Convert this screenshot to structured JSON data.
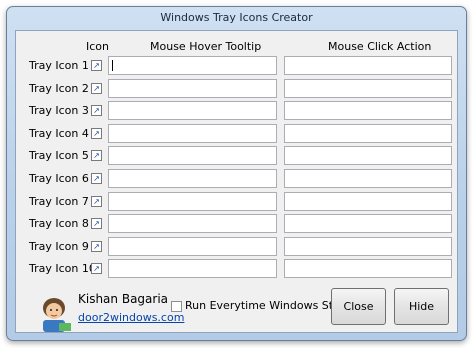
{
  "window": {
    "title": "Windows Tray Icons Creator"
  },
  "headers": {
    "icon": "Icon",
    "tooltip": "Mouse Hover Tooltip",
    "action": "Mouse Click Action"
  },
  "rows": [
    {
      "label": "Tray Icon 1",
      "tooltip": "",
      "action": ""
    },
    {
      "label": "Tray Icon 2",
      "tooltip": "",
      "action": ""
    },
    {
      "label": "Tray Icon 3",
      "tooltip": "",
      "action": ""
    },
    {
      "label": "Tray Icon 4",
      "tooltip": "",
      "action": ""
    },
    {
      "label": "Tray Icon 5",
      "tooltip": "",
      "action": ""
    },
    {
      "label": "Tray Icon 6",
      "tooltip": "",
      "action": ""
    },
    {
      "label": "Tray Icon 7",
      "tooltip": "",
      "action": ""
    },
    {
      "label": "Tray Icon 8",
      "tooltip": "",
      "action": ""
    },
    {
      "label": "Tray Icon 9",
      "tooltip": "",
      "action": ""
    },
    {
      "label": "Tray Icon 10",
      "tooltip": "",
      "action": ""
    }
  ],
  "row_icon": "shortcut-icon",
  "footer": {
    "author": "Kishan Bagaria",
    "website": "door2windows.com",
    "startup_label": "Run Everytime Windows Starts Up",
    "startup_checked": false,
    "close_label": "Close",
    "hide_label": "Hide"
  },
  "colors": {
    "link": "#0645ad",
    "title_bar": "#b9d0ea",
    "client_bg": "#f0f0f0"
  }
}
